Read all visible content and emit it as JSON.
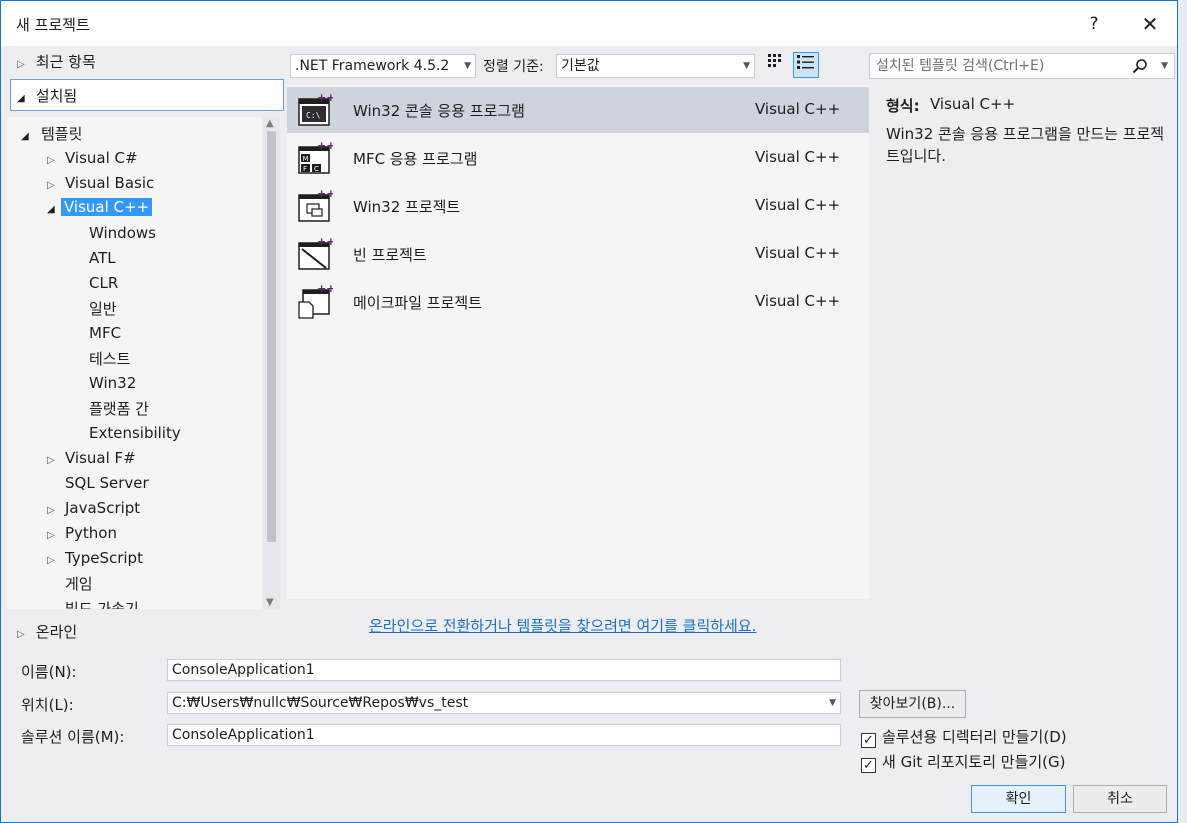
{
  "window": {
    "title": "새 프로젝트",
    "help_label": "?",
    "close_label": "✕"
  },
  "left": {
    "recent_label": "최근 항목",
    "installed_label": "설치됨",
    "online_label": "온라인",
    "tree": [
      {
        "label": "템플릿",
        "expanded": true
      },
      {
        "label": "Visual C#"
      },
      {
        "label": "Visual Basic"
      },
      {
        "label": "Visual C++",
        "expanded": true,
        "selected": true
      },
      {
        "label": "Windows"
      },
      {
        "label": "ATL"
      },
      {
        "label": "CLR"
      },
      {
        "label": "일반"
      },
      {
        "label": "MFC"
      },
      {
        "label": "테스트"
      },
      {
        "label": "Win32"
      },
      {
        "label": "플랫폼 간"
      },
      {
        "label": "Extensibility"
      },
      {
        "label": "Visual F#"
      },
      {
        "label": "SQL Server"
      },
      {
        "label": "JavaScript"
      },
      {
        "label": "Python"
      },
      {
        "label": "TypeScript"
      },
      {
        "label": "게임"
      },
      {
        "label": "빌드 가속기"
      }
    ]
  },
  "toolbar": {
    "framework_value": ".NET Framework 4.5.2",
    "sort_label": "정렬 기준:",
    "sort_value": "기본값",
    "search_placeholder": "설치된 템플릿 검색(Ctrl+E)"
  },
  "templates": [
    {
      "name": "Win32 콘솔 응용 프로그램",
      "lang": "Visual C++",
      "icon": "console-app-icon",
      "selected": true
    },
    {
      "name": "MFC 응용 프로그램",
      "lang": "Visual C++",
      "icon": "mfc-app-icon"
    },
    {
      "name": "Win32 프로젝트",
      "lang": "Visual C++",
      "icon": "win32-project-icon"
    },
    {
      "name": "빈 프로젝트",
      "lang": "Visual C++",
      "icon": "empty-project-icon"
    },
    {
      "name": "메이크파일 프로젝트",
      "lang": "Visual C++",
      "icon": "makefile-project-icon"
    }
  ],
  "description": {
    "type_label": "형식:",
    "type_value": "Visual C++",
    "text": "Win32 콘솔 응용 프로그램을 만드는 프로젝트입니다."
  },
  "online_link": "온라인으로 전환하거나 템플릿을 찾으려면 여기를 클릭하세요.",
  "form": {
    "name_label": "이름(N):",
    "name_value": "ConsoleApplication1",
    "location_label": "위치(L):",
    "location_value": "C:₩Users₩nullc₩Source₩Repos₩vs_test",
    "solution_label": "솔루션 이름(M):",
    "solution_value": "ConsoleApplication1",
    "browse_label": "찾아보기(B)...",
    "create_dir_label": "솔루션용 디렉터리 만들기(D)",
    "create_dir_checked": true,
    "git_label": "새 Git 리포지토리 만들기(G)",
    "git_checked": true
  },
  "buttons": {
    "ok": "확인",
    "cancel": "취소"
  },
  "colors": {
    "accent": "#3399ff",
    "link": "#1a6fc9",
    "selected_row": "#cfd3dc",
    "dialog_bg": "#eeeef2",
    "icon_purple": "#68217a"
  }
}
